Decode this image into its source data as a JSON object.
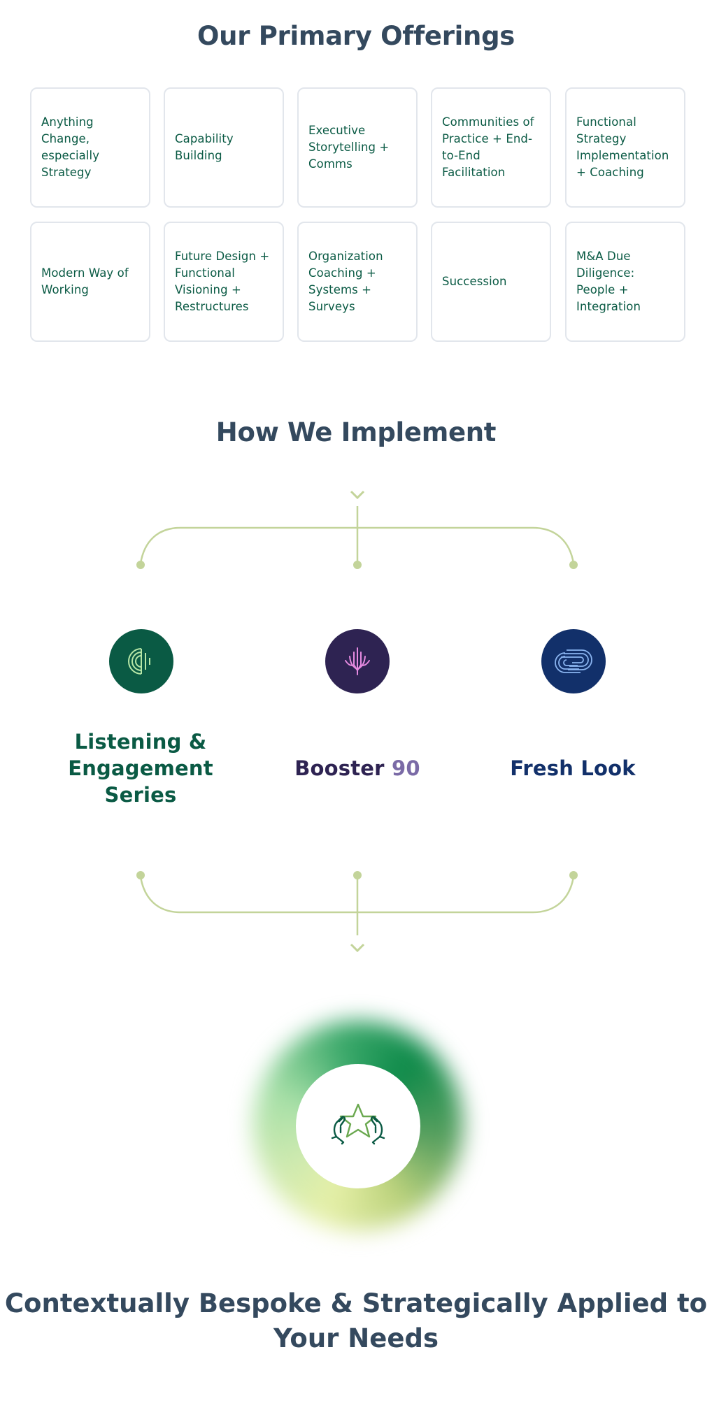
{
  "offerings": {
    "title": "Our Primary Offerings",
    "items": [
      "Anything Change, especially Strategy",
      "Capability Building",
      "Executive Storytelling + Comms",
      "Communities of Practice + End-to-End Facilitation",
      "Functional Strategy Implementation + Coaching",
      "Modern Way of Working",
      "Future Design + Functional Visioning + Restructures",
      "Organization Coaching + Systems + Surveys",
      "Succession",
      "M&A Due Diligence: People + Integration"
    ]
  },
  "implement": {
    "title": "How We Implement",
    "connector_color": "#c3d49a",
    "programs": [
      {
        "name": "Listening & Engagement Series",
        "icon": "listening-soundwave-icon",
        "color": "#0a5a44",
        "icon_bg": "#0a5a44",
        "icon_fg": "#b6e6a6"
      },
      {
        "name_main": "Booster",
        "name_accent": "90",
        "icon": "booster-wheat-icon",
        "color": "#2e2352",
        "accent_color": "#7a6aa6",
        "icon_bg": "#2e2352",
        "icon_fg": "#e58ae0"
      },
      {
        "name": "Fresh Look",
        "icon": "fresh-look-swirl-icon",
        "color": "#12306a",
        "icon_bg": "#12306a",
        "icon_fg": "#8ab4f0"
      }
    ]
  },
  "closing": {
    "icon": "hands-holding-star-icon",
    "title": "Contextually Bespoke & Strategically Applied to Your Needs"
  }
}
